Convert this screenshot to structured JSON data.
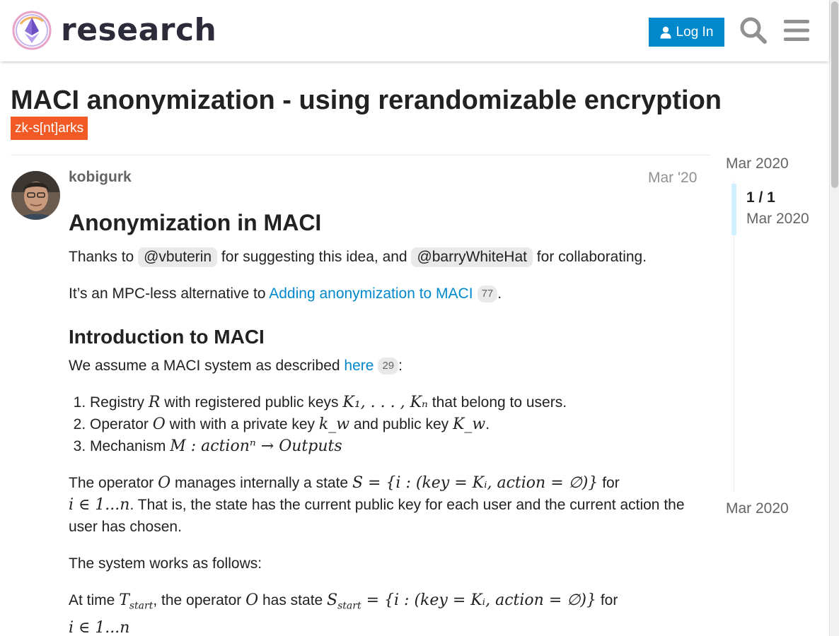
{
  "header": {
    "logo_text": "research",
    "login_label": "Log In",
    "search_icon": "search-icon",
    "menu_icon": "hamburger-menu-icon"
  },
  "topic": {
    "title": "MACI anonymization - using rerandomizable encryption",
    "tag": "zk-s[nt]arks"
  },
  "post": {
    "username": "kobigurk",
    "date": "Mar '20",
    "heading": "Anonymization in MACI",
    "thanks_prefix": "Thanks to ",
    "mention_1": "@vbuterin",
    "thanks_middle": " for suggesting this idea, and ",
    "mention_2": "@barryWhiteHat",
    "thanks_suffix": " for collaborating.",
    "alt_prefix": "It’s an MPC-less alternative to ",
    "alt_link": "Adding anonymization to MACI",
    "alt_clicks": "77",
    "alt_suffix": ".",
    "intro_heading": "Introduction to MACI",
    "assume_prefix": "We assume a MACI system as described ",
    "assume_link": "here",
    "assume_clicks": "29",
    "assume_suffix": ":",
    "list": [
      {
        "a": "Registry ",
        "m1": "R",
        "b": " with registered public keys ",
        "m2": "K₁, . . . , Kₙ",
        "c": " that belong to users."
      },
      {
        "a": "Operator ",
        "m1": "O",
        "b": " with with a private key ",
        "m2": "k_w",
        "c": " and public key ",
        "m3": "K_w",
        "d": "."
      },
      {
        "a": "Mechanism ",
        "m1": "M : actionⁿ → Outputs"
      }
    ],
    "state_prefix": "The operator ",
    "state_O": "O",
    "state_mid": " manages internally a state ",
    "state_formula": "S = {i : (key = Kᵢ, action = ∅)}",
    "state_for": " for",
    "state_range": "i ∈ 1...n",
    "state_rest": ". That is, the state has the current public key for each user and the current action the user has chosen.",
    "works": "The system works as follows:",
    "time_prefix": "At time ",
    "time_T": "T",
    "time_T_sub": "start",
    "time_mid": ", the operator ",
    "time_O": "O",
    "time_has": " has state ",
    "time_S": "S",
    "time_S_sub": "start",
    "time_formula": " = {i : (key = Kᵢ, action = ∅)}",
    "time_for": " for",
    "time_range": "i ∈ 1...n"
  },
  "timeline": {
    "top_date": "Mar 2020",
    "count": "1 / 1",
    "count_date": "Mar 2020",
    "bottom_date": "Mar 2020"
  },
  "colors": {
    "accent": "#0088cc",
    "tag": "#f15a24",
    "mention_bg": "#e9e9e9"
  }
}
